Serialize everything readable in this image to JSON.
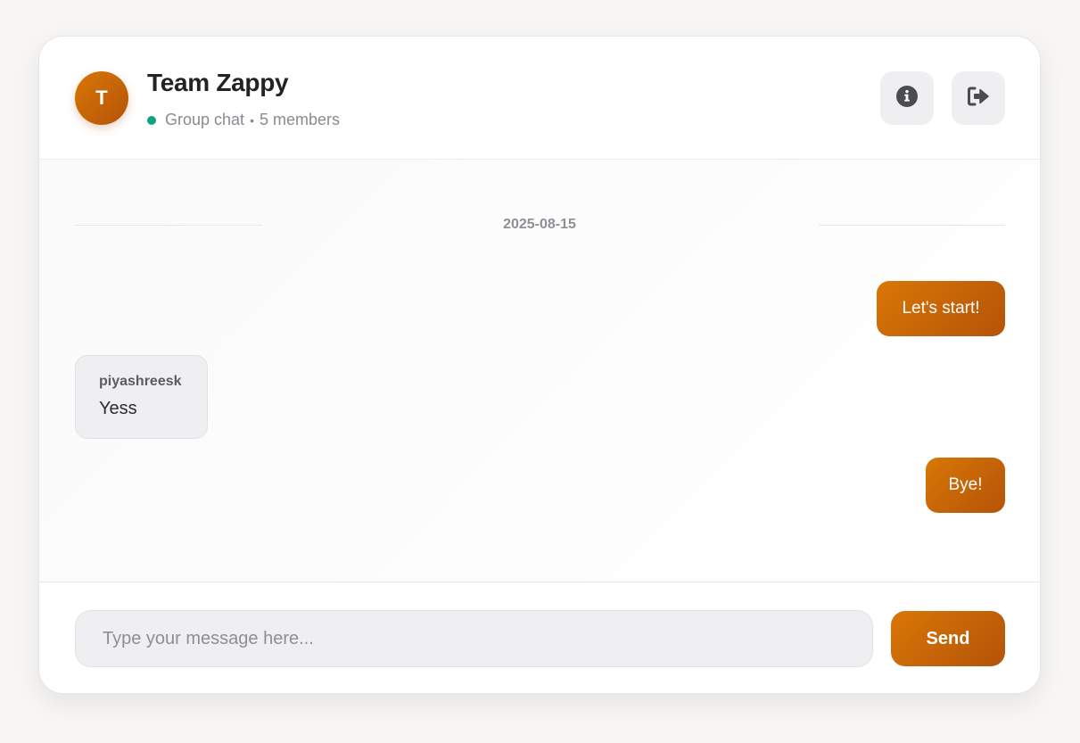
{
  "header": {
    "avatar_initial": "T",
    "title": "Team Zappy",
    "chat_type": "Group chat",
    "separator": "•",
    "members": "5 members",
    "status_color": "#10a37f",
    "info_icon": "info-circle-icon",
    "leave_icon": "sign-out-icon"
  },
  "conversation": {
    "date": "2025-08-15",
    "messages": [
      {
        "direction": "outgoing",
        "text": "Let's start!"
      },
      {
        "direction": "incoming",
        "sender": "piyashreesk",
        "text": "Yess"
      },
      {
        "direction": "outgoing",
        "text": "Bye!"
      }
    ]
  },
  "composer": {
    "value": "",
    "placeholder": "Type your message here...",
    "send_label": "Send"
  },
  "colors": {
    "accent_start": "#d97706",
    "accent_end": "#b45309",
    "background": "#f7f6f4",
    "bubble_in": "#efeff1"
  }
}
